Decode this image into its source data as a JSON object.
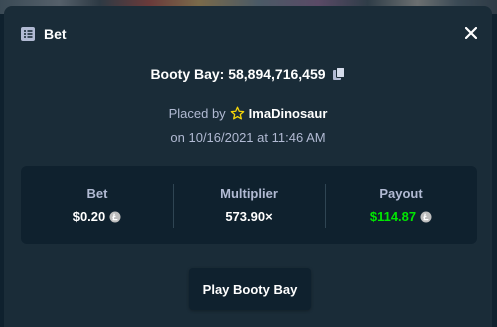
{
  "modal": {
    "title": "Bet",
    "header_icon": "receipt-icon",
    "close_icon": "close-icon"
  },
  "game": {
    "name_id": "Booty Bay: 58,894,716,459",
    "copy_icon": "copy-icon"
  },
  "placed": {
    "prefix": "Placed by",
    "user_icon": "star-icon",
    "username": "ImaDinosaur",
    "date_text": "on 10/16/2021 at 11:46 AM"
  },
  "stats": {
    "bet_label": "Bet",
    "bet_value": "$0.20",
    "multiplier_label": "Multiplier",
    "multiplier_value": "573.90×",
    "payout_label": "Payout",
    "payout_value": "$114.87",
    "currency_icon": "litecoin-icon"
  },
  "actions": {
    "play_label": "Play Booty Bay"
  },
  "colors": {
    "background": "#0f212e",
    "modal": "#1a2c38",
    "text_secondary": "#b1bad3",
    "win_green": "#00e701",
    "star": "#f5d50a"
  }
}
